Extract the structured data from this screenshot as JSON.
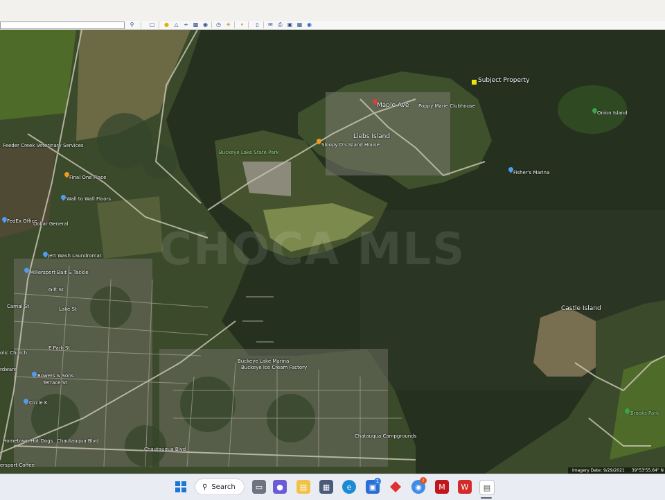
{
  "toolbar": {
    "icons": [
      "search-icon",
      "map-icon",
      "pin-icon",
      "polygon-icon",
      "path-icon",
      "overlay-icon",
      "tour-icon",
      "sun-icon",
      "planet-icon",
      "history-icon",
      "ruler-icon",
      "email-icon",
      "print-icon",
      "save-image-icon",
      "maps-view-icon",
      "earth-icon"
    ]
  },
  "map": {
    "watermark": "CHOCA MLS",
    "labels": {
      "subject_property": "Subject Property",
      "maple_ave": "Maple Ave",
      "poppy_clubhouse": "Poppy Marie Clubhouse",
      "onion_island": "Onion Island",
      "lieb_island": "Liebs Island",
      "buckeye_state_park": "Buckeye Lake State Park",
      "sloopy_island_house": "Sloopy D's Island House",
      "fishers_marina": "Fisher's Marina",
      "feeder_creek": "Feeder Creek Veterinary Services",
      "final_one_place": "Final One Place",
      "wall_to_wall": "Wall to Wall Floors",
      "dollar_general": "Dollar General",
      "fedex": "FedEx Office",
      "jet_wash": "Jett Wash Laundromat",
      "millersport_bait": "Millersport Bait & Tackle",
      "castle_island": "Castle Island",
      "buckeye_marina": "Buckeye Lake Marina",
      "ice_cream": "Buckeye Ice Cream Factory",
      "bowers_sons": "Bowers & Sons",
      "terrace_st": "Terrace St",
      "circle_k": "Circle K",
      "catholic_church": "olic Church",
      "hometown_hot_dogs": "Hometown Hot Dogs",
      "chautauqua_blvd": "Chautauqua Blvd",
      "chautauqua_blvd2": "Chautauqua Blvd",
      "campgrounds": "Chatauqua Campgrounds",
      "brooks_park": "Brooks Park",
      "coffee": "ersport Coffee",
      "gift_st": "Gift St",
      "lake_st": "Lake St",
      "e_park_st": "E Park St",
      "carnal_st": "Carnal St",
      "hardware": "rdware"
    },
    "attribution": {
      "imagery_date": "Imagery Date: 9/29/2021",
      "coords": "39°53'55.64\" N"
    },
    "colors": {
      "water": "#26301f",
      "land": "#3c4d2a",
      "field": "#5a6b3a",
      "road": "#c9c4b3"
    }
  },
  "taskbar": {
    "search_label": "Search",
    "icons": [
      "windows-start-icon",
      "taskview-icon",
      "teams-icon",
      "file-explorer-icon",
      "calculator-icon",
      "edge-icon",
      "store-icon",
      "app-red-icon",
      "chrome-icon",
      "mcafee-icon",
      "wps-icon",
      "document-icon"
    ],
    "store_badge": "1",
    "chrome_badge": "!"
  }
}
